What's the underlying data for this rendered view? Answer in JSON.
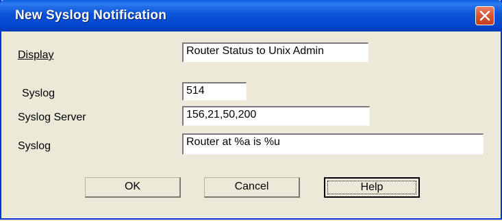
{
  "window": {
    "title": "New Syslog Notification"
  },
  "form": {
    "display_label": "Display",
    "display_value": "Router Status to Unix Admin",
    "syslog_port_label": "Syslog",
    "syslog_port_value": "514",
    "syslog_server_label": "Syslog Server",
    "syslog_server_value": "156,21,50,200",
    "syslog_message_label": "Syslog",
    "syslog_message_value": "Router at %a is %u"
  },
  "buttons": {
    "ok": "OK",
    "cancel": "Cancel",
    "help": "Help"
  },
  "icons": {
    "close": "close-icon"
  },
  "colors": {
    "titlebar": "#0a53d8",
    "close_button": "#d8532f",
    "dialog_background": "#ece9d8"
  }
}
